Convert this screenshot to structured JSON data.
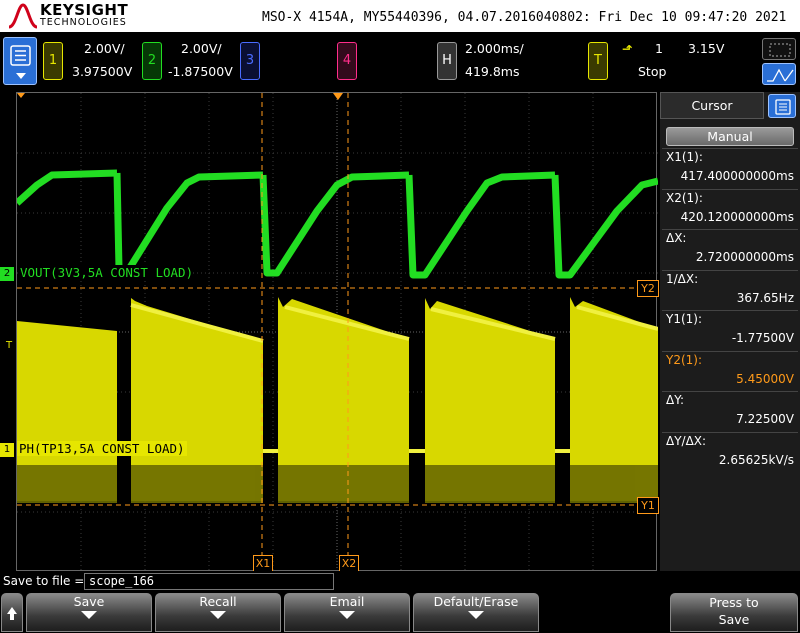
{
  "header": {
    "brand": "KEYSIGHT",
    "brand_sub": "TECHNOLOGIES",
    "device_title": "MSO-X 4154A, MY55440396, 04.07.2016040802: Fri Dec 10 09:47:20 2021"
  },
  "channels": [
    {
      "num": "1",
      "scale": "2.00V/",
      "offset": "3.97500V",
      "color": "#e6e600"
    },
    {
      "num": "2",
      "scale": "2.00V/",
      "offset": "-1.87500V",
      "color": "#22dd22"
    },
    {
      "num": "3",
      "color": "#4a6cff"
    },
    {
      "num": "4",
      "color": "#ff2d8a"
    }
  ],
  "horizontal": {
    "key": "H",
    "timebase": "2.000ms/",
    "position": "419.8ms"
  },
  "trigger": {
    "key": "T",
    "symbol": "⬏",
    "source": "1",
    "level": "3.15V",
    "status": "Stop"
  },
  "waveform_labels": {
    "ch2": "VOUT(3V3,5A CONST LOAD)",
    "ch1": "PH(TP13,5A CONST LOAD)",
    "ch1_marker": "1",
    "ch2_marker": "2",
    "trig_marker": "T"
  },
  "cursor_markers": {
    "x1": "X1",
    "x2": "X2",
    "y1": "Y1",
    "y2": "Y2"
  },
  "sidebar": {
    "title": "Cursor",
    "mode": "Manual",
    "rows": [
      {
        "label": "X1(1):",
        "value": "417.400000000ms",
        "highlight": false
      },
      {
        "label": "X2(1):",
        "value": "420.120000000ms",
        "highlight": false
      },
      {
        "label": "ΔX:",
        "value": "2.720000000ms",
        "highlight": false
      },
      {
        "label": "1/ΔX:",
        "value": "367.65Hz",
        "highlight": false
      },
      {
        "label": "Y1(1):",
        "value": "-1.77500V",
        "highlight": false
      },
      {
        "label": "Y2(1):",
        "value": "5.45000V",
        "highlight": true
      },
      {
        "label": "ΔY:",
        "value": "7.22500V",
        "highlight": false
      },
      {
        "label": "ΔY/ΔX:",
        "value": "2.65625kV/s",
        "highlight": false
      }
    ],
    "highlight_color": "#ff9a1a"
  },
  "save": {
    "label": "Save to file =",
    "filename": "scope_166"
  },
  "softkeys": [
    "Save",
    "Recall",
    "Email",
    "Default/Erase"
  ],
  "press_to_save": {
    "line1": "Press to",
    "line2": "Save"
  }
}
